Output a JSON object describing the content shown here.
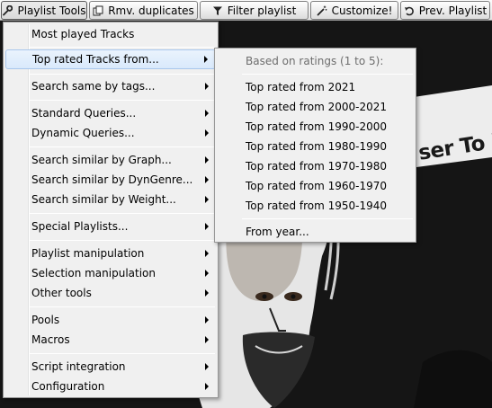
{
  "toolbar": {
    "buttons": [
      {
        "label": "Playlist Tools",
        "icon": "wrench-icon"
      },
      {
        "label": "Rmv. duplicates",
        "icon": "duplicates-icon"
      },
      {
        "label": "Filter playlist",
        "icon": "filter-icon"
      },
      {
        "label": "Customize!",
        "icon": "wand-icon"
      },
      {
        "label": "Prev. Playlist",
        "icon": "undo-icon"
      }
    ]
  },
  "background": {
    "banner_text": "ser To I"
  },
  "main_menu": {
    "items": [
      {
        "label": "Most played Tracks",
        "submenu": false
      },
      {
        "label": "Top rated Tracks from...",
        "submenu": true,
        "highlighted": true
      },
      {
        "label": "Search same by tags...",
        "submenu": true
      },
      {
        "label": "Standard Queries...",
        "submenu": true
      },
      {
        "label": "Dynamic Queries...",
        "submenu": true
      },
      {
        "label": "Search similar by Graph...",
        "submenu": true
      },
      {
        "label": "Search similar by DynGenre...",
        "submenu": true
      },
      {
        "label": "Search similar by Weight...",
        "submenu": true
      },
      {
        "label": "Special Playlists...",
        "submenu": true
      },
      {
        "label": "Playlist manipulation",
        "submenu": true
      },
      {
        "label": "Selection manipulation",
        "submenu": true
      },
      {
        "label": "Other tools",
        "submenu": true
      },
      {
        "label": "Pools",
        "submenu": true
      },
      {
        "label": "Macros",
        "submenu": true
      },
      {
        "label": "Script integration",
        "submenu": true
      },
      {
        "label": "Configuration",
        "submenu": true
      }
    ]
  },
  "sub_menu": {
    "header": "Based on ratings (1 to 5):",
    "items": [
      "Top rated from 2021",
      "Top rated from 2000-2021",
      "Top rated from 1990-2000",
      "Top rated from 1980-1990",
      "Top rated from 1970-1980",
      "Top rated from 1960-1970",
      "Top rated from 1950-1940"
    ],
    "from_year": "From year..."
  }
}
